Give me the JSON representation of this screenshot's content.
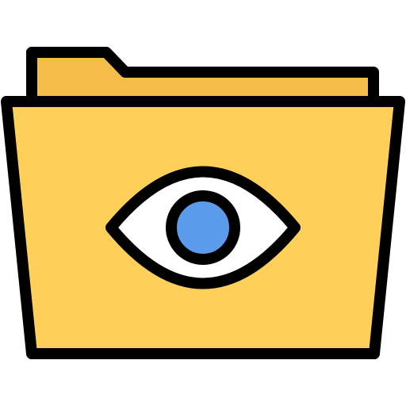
{
  "icon": {
    "name": "folder-eye-icon",
    "colors": {
      "outline": "#000000",
      "folder_front": "#FFD059",
      "folder_back": "#F5BD47",
      "eye_white": "#FFFFFF",
      "iris": "#5B9BEB"
    }
  }
}
